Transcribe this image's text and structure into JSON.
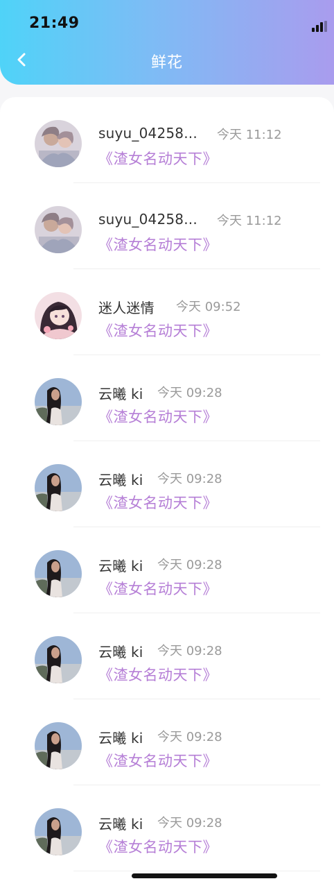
{
  "status_bar": {
    "time": "21:49"
  },
  "header": {
    "title": "鲜花",
    "back_icon": "chevron-left-icon",
    "gradient_colors": [
      "#4fd3f8",
      "#a99cee"
    ]
  },
  "colors": {
    "book_title": "#b57ed6",
    "timestamp": "#9a9a9a",
    "username": "#333333"
  },
  "list": [
    {
      "name": "suyu_04258...",
      "time": "今天 11:12",
      "book": "《渣女名动天下》",
      "avatar": "couple-avatar"
    },
    {
      "name": "suyu_04258...",
      "time": "今天 11:12",
      "book": "《渣女名动天下》",
      "avatar": "couple-avatar"
    },
    {
      "name": "迷人迷情",
      "time": "今天 09:52",
      "book": "《渣女名动天下》",
      "avatar": "anime-girl-avatar"
    },
    {
      "name": "云曦 ki",
      "time": "今天 09:28",
      "book": "《渣女名动天下》",
      "avatar": "woman-sky-avatar"
    },
    {
      "name": "云曦 ki",
      "time": "今天 09:28",
      "book": "《渣女名动天下》",
      "avatar": "woman-sky-avatar"
    },
    {
      "name": "云曦 ki",
      "time": "今天 09:28",
      "book": "《渣女名动天下》",
      "avatar": "woman-sky-avatar"
    },
    {
      "name": "云曦 ki",
      "time": "今天 09:28",
      "book": "《渣女名动天下》",
      "avatar": "woman-sky-avatar"
    },
    {
      "name": "云曦 ki",
      "time": "今天 09:28",
      "book": "《渣女名动天下》",
      "avatar": "woman-sky-avatar"
    },
    {
      "name": "云曦 ki",
      "time": "今天 09:28",
      "book": "《渣女名动天下》",
      "avatar": "woman-sky-avatar"
    }
  ]
}
